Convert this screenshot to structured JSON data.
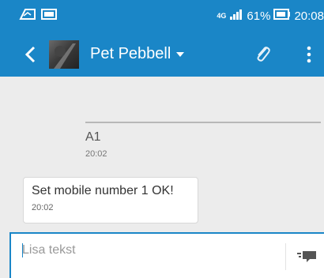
{
  "status_bar": {
    "network_type": "4G",
    "battery_percent": "61%",
    "time": "20:08"
  },
  "app_bar": {
    "contact_name": "Pet Pebbell",
    "back_icon": "back-arrow-icon",
    "attach_icon": "paperclip-icon",
    "menu_icon": "overflow-menu-icon"
  },
  "messages": [
    {
      "direction": "sent",
      "text": "A1",
      "time": "20:02"
    },
    {
      "direction": "received",
      "text": "Set mobile number 1 OK!",
      "time": "20:02"
    }
  ],
  "composer": {
    "placeholder": "Lisa tekst",
    "send_icon": "send-icon"
  },
  "colors": {
    "accent": "#1a86c7",
    "background": "#ececec",
    "bubble": "#ffffff"
  }
}
